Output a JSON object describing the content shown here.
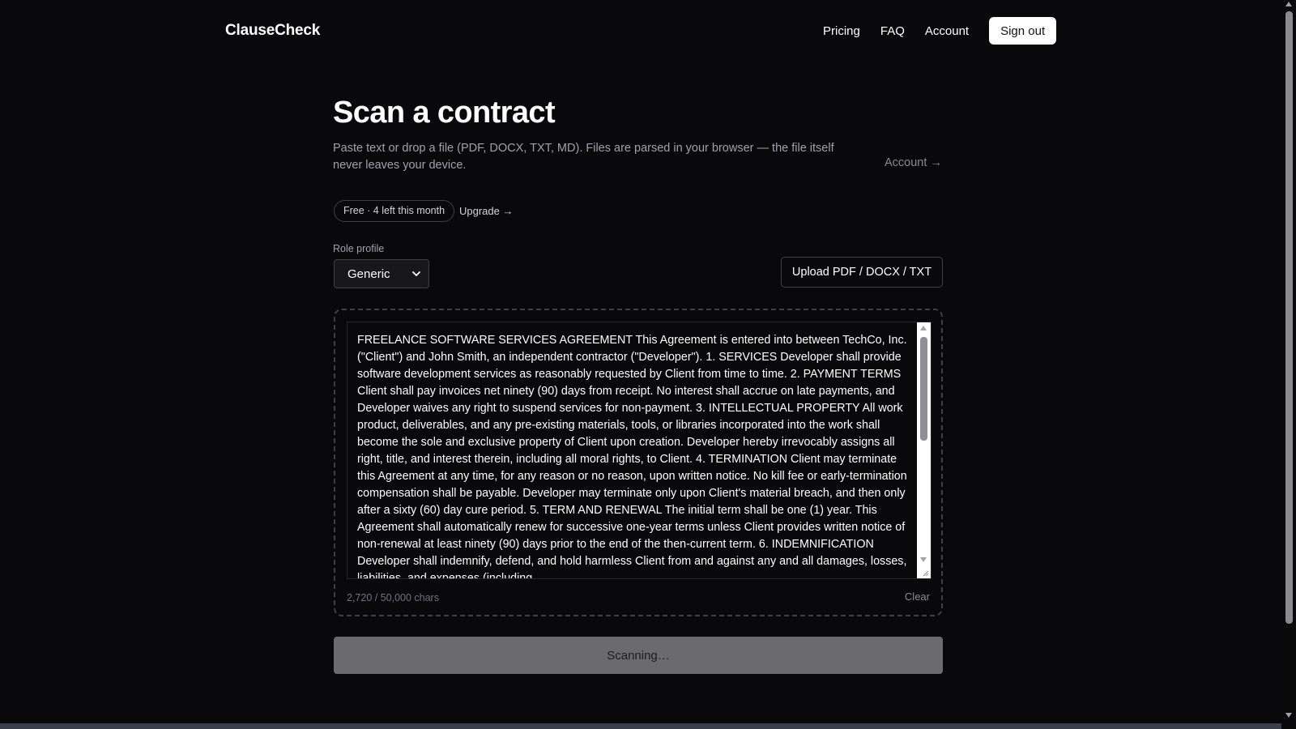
{
  "header": {
    "brand": "ClauseCheck",
    "nav": {
      "pricing": "Pricing",
      "faq": "FAQ",
      "account": "Account",
      "sign_out": "Sign out"
    }
  },
  "main": {
    "title": "Scan a contract",
    "subtitle": "Paste text or drop a file (PDF, DOCX, TXT, MD). Files are parsed in your browser — the file itself never leaves your device.",
    "account_link": "Account →",
    "plan_badge": "Free · 4 left this month",
    "upgrade_link": "Upgrade →",
    "role_profile": {
      "label": "Role profile",
      "selected": "Generic"
    },
    "upload_button": "Upload PDF / DOCX / TXT",
    "contract_text": "FREELANCE SOFTWARE SERVICES AGREEMENT This Agreement is entered into between TechCo, Inc. (\"Client\") and John Smith, an independent contractor (\"Developer\"). 1. SERVICES Developer shall provide software development services as reasonably requested by Client from time to time. 2. PAYMENT TERMS Client shall pay invoices net ninety (90) days from receipt. No interest shall accrue on late payments, and Developer waives any right to suspend services for non-payment. 3. INTELLECTUAL PROPERTY All work product, deliverables, and any pre-existing materials, tools, or libraries incorporated into the work shall become the sole and exclusive property of Client upon creation. Developer hereby irrevocably assigns all right, title, and interest therein, including all moral rights, to Client. 4. TERMINATION Client may terminate this Agreement at any time, for any reason or no reason, upon written notice. No kill fee or early-termination compensation shall be payable. Developer may terminate only upon Client's material breach, and then only after a sixty (60) day cure period. 5. TERM AND RENEWAL The initial term shall be one (1) year. This Agreement shall automatically renew for successive one-year terms unless Client provides written notice of non-renewal at least ninety (90) days prior to the end of the then-current term. 6. INDEMNIFICATION Developer shall indemnify, defend, and hold harmless Client from and against any and all damages, losses, liabilities, and expenses (including",
    "char_count": "2,720 / 50,000 chars",
    "clear_button": "Clear",
    "scan_button": "Scanning…"
  },
  "colors": {
    "background": "#09090b",
    "muted_text": "#a1a1aa",
    "border": "#3f3f46",
    "scan_button_disabled": "#6b6b6f"
  }
}
